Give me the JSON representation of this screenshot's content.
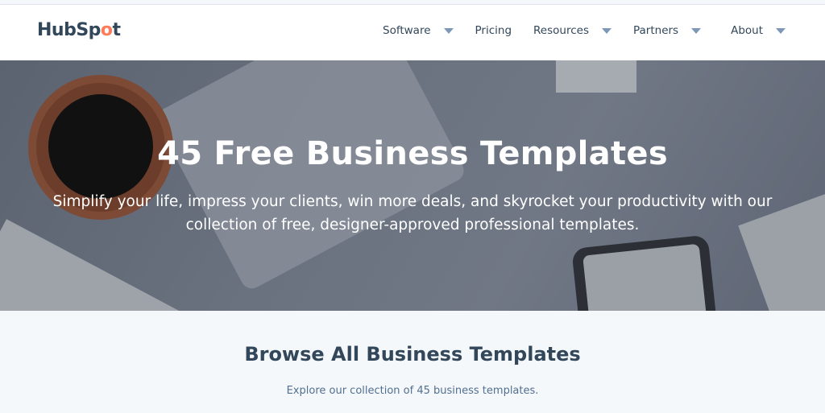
{
  "brand": {
    "logo_text_pre": "HubSp",
    "logo_text_o": "o",
    "logo_text_post": "t",
    "accent": "#ff7a59"
  },
  "nav": {
    "items": [
      {
        "label": "Software",
        "dropdown": true
      },
      {
        "label": "Pricing",
        "dropdown": false
      },
      {
        "label": "Resources",
        "dropdown": true
      },
      {
        "label": "Partners",
        "dropdown": true
      },
      {
        "label": "About",
        "dropdown": true
      }
    ]
  },
  "hero": {
    "title": "45 Free Business Templates",
    "subtitle": "Simplify your life, impress your clients, win more deals, and skyrocket your productivity with our collection of free, designer-approved professional templates."
  },
  "browse": {
    "title": "Browse All Business Templates",
    "subtitle": "Explore our collection of 45 business templates."
  }
}
